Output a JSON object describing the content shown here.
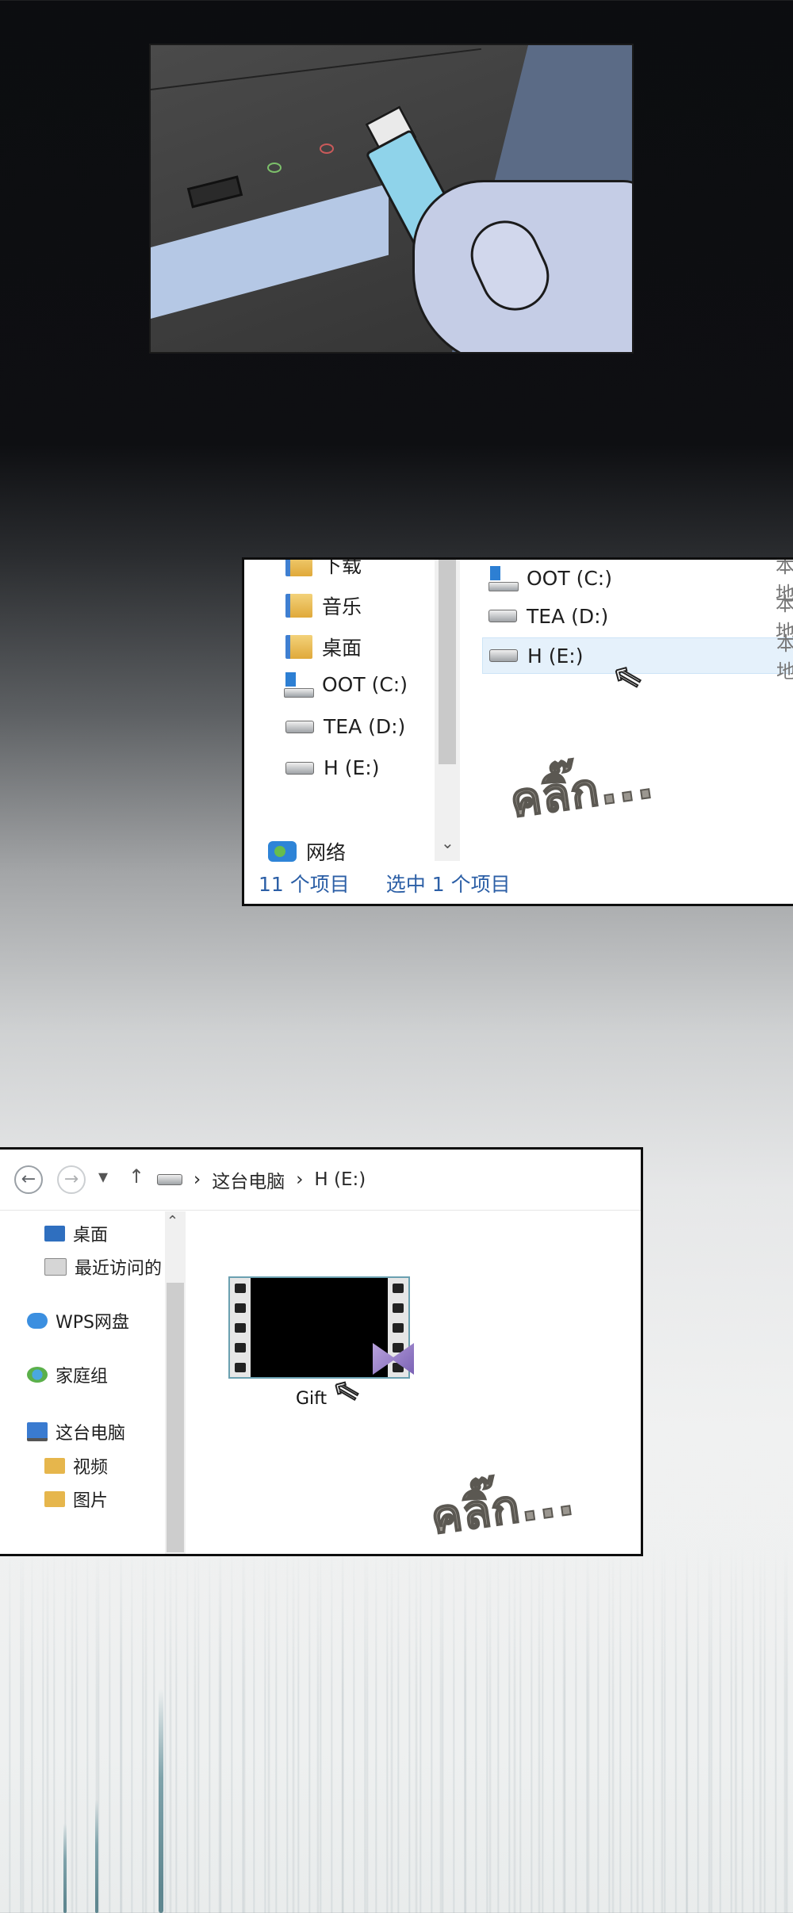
{
  "panel2": {
    "nav": {
      "downloads": "下载",
      "music": "音乐",
      "desktop": "桌面",
      "c_drive": "OOT (C:)",
      "d_drive": "TEA (D:)",
      "e_drive": "H (E:)",
      "network": "网络"
    },
    "files": [
      {
        "name": "OOT (C:)",
        "type": "本地"
      },
      {
        "name": "TEA (D:)",
        "type": "本地"
      },
      {
        "name": "H (E:)",
        "type": "本地"
      }
    ],
    "status_count": "11 个项目",
    "status_selected": "选中 1 个项目",
    "sfx": "คลิ๊ก..."
  },
  "panel3": {
    "nav_back": "←",
    "nav_forward": "→",
    "nav_recent": "▾",
    "nav_up": "↑",
    "breadcrumb_sep": "›",
    "breadcrumb_pc": "这台电脑",
    "breadcrumb_drive": "H (E:)",
    "nav": {
      "desktop": "桌面",
      "recent": "最近访问的",
      "wps": "WPS网盘",
      "homegroup": "家庭组",
      "this_pc": "这台电脑",
      "videos": "视频",
      "pictures": "图片"
    },
    "file_name": "Gift",
    "sfx": "คลิ๊ก..."
  },
  "colors": {
    "selection": "#e5f1fb",
    "status_text": "#2c5fa6",
    "usb_body": "#8fd3ea",
    "wmv_icon": "#7b62b5"
  },
  "icons": [
    "folder-icon",
    "drive-icon",
    "windows-drive-icon",
    "network-icon",
    "cursor-icon",
    "onedrive-icon",
    "homegroup-icon",
    "computer-icon",
    "video-file-icon"
  ]
}
